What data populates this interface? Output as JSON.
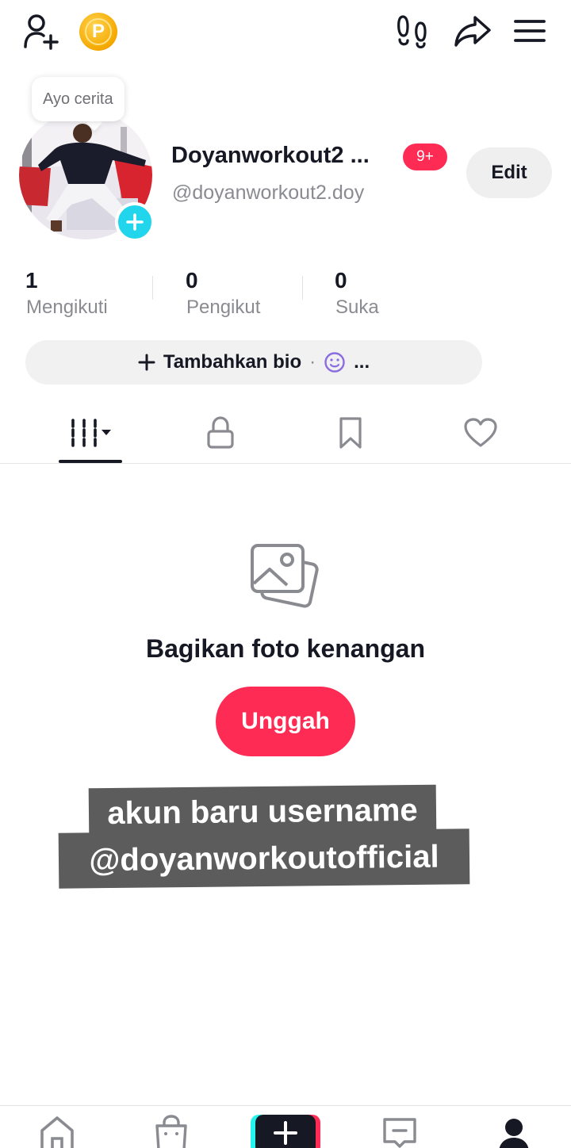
{
  "header": {
    "add_friend_icon": "person-plus-icon",
    "coin_icon": "coin-p-icon",
    "coin_letter": "P",
    "footprints_icon": "footprints-icon",
    "share_icon": "share-arrow-icon",
    "menu_icon": "hamburger-menu-icon"
  },
  "profile": {
    "story_bubble": "Ayo cerita",
    "display_name": "Doyanworkout2 ...",
    "notification_badge": "9+",
    "handle": "@doyanworkout2.doy",
    "edit_label": "Edit"
  },
  "stats": [
    {
      "value": "1",
      "label": "Mengikuti"
    },
    {
      "value": "0",
      "label": "Pengikut"
    },
    {
      "value": "0",
      "label": "Suka"
    }
  ],
  "bio": {
    "add_label": "Tambahkan bio",
    "separator": "·",
    "more": "..."
  },
  "tabs": [
    {
      "icon": "grid-videos-icon",
      "active": true
    },
    {
      "icon": "lock-icon",
      "active": false
    },
    {
      "icon": "bookmark-icon",
      "active": false
    },
    {
      "icon": "heart-icon",
      "active": false
    }
  ],
  "empty_state": {
    "icon": "photo-stack-icon",
    "title": "Bagikan foto kenangan",
    "button_label": "Unggah"
  },
  "overlay_caption": {
    "line1": "akun baru username",
    "line2": "@doyanworkoutofficial"
  },
  "bottom_nav": [
    {
      "icon": "home-icon"
    },
    {
      "icon": "shop-bag-icon"
    },
    {
      "icon": "create-plus-icon"
    },
    {
      "icon": "inbox-icon"
    },
    {
      "icon": "profile-icon",
      "active": true
    }
  ],
  "colors": {
    "accent": "#fe2c55",
    "cyan": "#25f4ee",
    "text": "#161823",
    "secondary_text": "#8a8b91"
  }
}
